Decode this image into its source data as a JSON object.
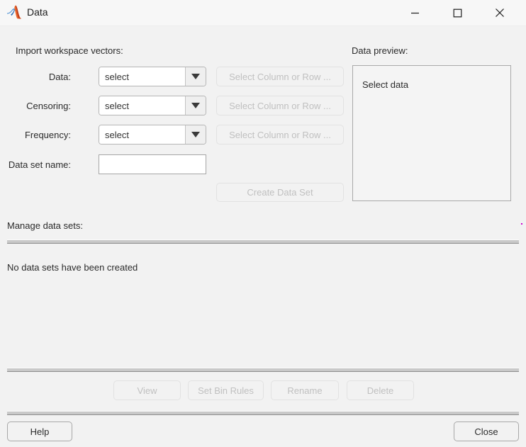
{
  "window": {
    "title": "Data",
    "logo_icon": "matlab-membrane-icon",
    "controls": {
      "minimize": "minimize-icon",
      "maximize": "maximize-icon",
      "close": "close-icon"
    }
  },
  "import_section": {
    "heading": "Import workspace vectors:",
    "rows": [
      {
        "label": "Data:",
        "combo_value": "select",
        "combo_icon": "chevron-down-icon",
        "column_button": "Select Column or Row ...",
        "column_button_enabled": false
      },
      {
        "label": "Censoring:",
        "combo_value": "select",
        "combo_icon": "chevron-down-icon",
        "column_button": "Select Column or Row ...",
        "column_button_enabled": false
      },
      {
        "label": "Frequency:",
        "combo_value": "select",
        "combo_icon": "chevron-down-icon",
        "column_button": "Select Column or Row ...",
        "column_button_enabled": false
      }
    ],
    "dataset_name_label": "Data set name:",
    "dataset_name_value": "",
    "dataset_name_placeholder": "",
    "create_button": "Create Data Set",
    "create_button_enabled": false
  },
  "preview_section": {
    "heading": "Data preview:",
    "body_text": "Select data"
  },
  "manage_section": {
    "heading": "Manage data sets:",
    "empty_text": "No data sets have been created",
    "buttons": [
      {
        "label": "View",
        "enabled": false
      },
      {
        "label": "Set Bin Rules",
        "enabled": false
      },
      {
        "label": "Rename",
        "enabled": false
      },
      {
        "label": "Delete",
        "enabled": false
      }
    ]
  },
  "footer": {
    "help_button": "Help",
    "close_button": "Close"
  },
  "colors": {
    "window_background": "#f2f2f2",
    "titlebar_background": "#f7f7f7",
    "field_border": "#a6a6a6",
    "disabled_text": "#c0c0c0",
    "text": "#2b2b2b",
    "logo_orange": "#e8652a",
    "logo_blue": "#3b78c4"
  }
}
